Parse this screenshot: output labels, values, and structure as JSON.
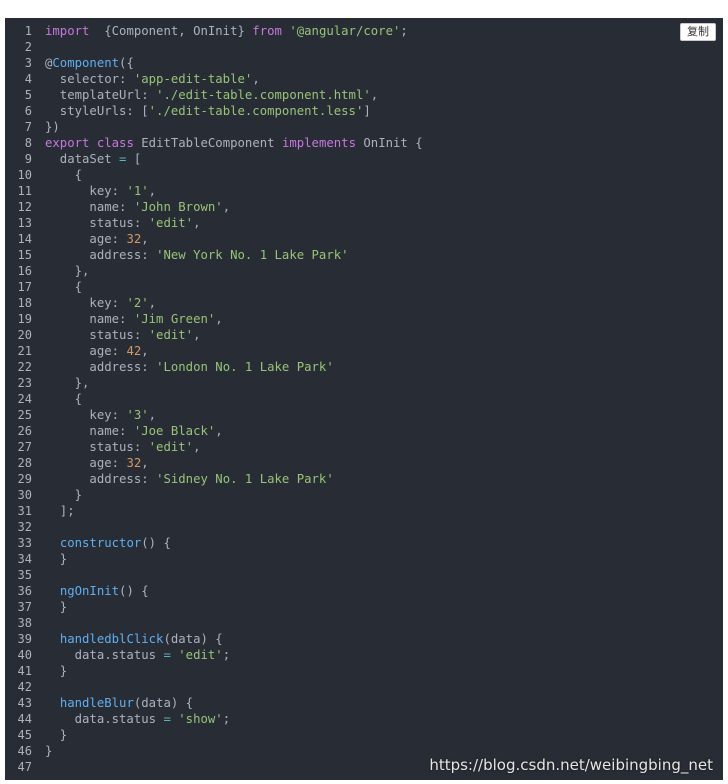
{
  "copy_button": {
    "label": "复制"
  },
  "watermark": "https://blog.csdn.net/weibingbing_net",
  "colors": {
    "background": "#282c34",
    "keyword": "#c678dd",
    "string": "#98c379",
    "function": "#61aeee",
    "number": "#d19a66",
    "text": "#abb2bf"
  },
  "lines": [
    {
      "n": "1",
      "t": [
        [
          "kw",
          "import"
        ],
        [
          "",
          "  {Component, OnInit} "
        ],
        [
          "kw",
          "from"
        ],
        [
          "",
          " "
        ],
        [
          "str",
          "'@angular/core'"
        ],
        [
          "",
          ";"
        ]
      ]
    },
    {
      "n": "2",
      "t": []
    },
    {
      "n": "3",
      "t": [
        [
          "",
          "@"
        ],
        [
          "fn",
          "Component"
        ],
        [
          "",
          "({"
        ]
      ]
    },
    {
      "n": "4",
      "t": [
        [
          "",
          "  selector: "
        ],
        [
          "str",
          "'app-edit-table'"
        ],
        [
          "",
          ","
        ]
      ]
    },
    {
      "n": "5",
      "t": [
        [
          "",
          "  templateUrl: "
        ],
        [
          "str",
          "'./edit-table.component.html'"
        ],
        [
          "",
          ","
        ]
      ]
    },
    {
      "n": "6",
      "t": [
        [
          "",
          "  styleUrls: ["
        ],
        [
          "str",
          "'./edit-table.component.less'"
        ],
        [
          "",
          "]"
        ]
      ]
    },
    {
      "n": "7",
      "t": [
        [
          "",
          "})"
        ]
      ]
    },
    {
      "n": "8",
      "t": [
        [
          "kw",
          "export"
        ],
        [
          "",
          " "
        ],
        [
          "kw",
          "class"
        ],
        [
          "",
          " EditTableComponent "
        ],
        [
          "kw",
          "implements"
        ],
        [
          "",
          " OnInit {"
        ]
      ]
    },
    {
      "n": "9",
      "t": [
        [
          "",
          "  dataSet "
        ],
        [
          "op",
          "="
        ],
        [
          "",
          " ["
        ]
      ]
    },
    {
      "n": "10",
      "t": [
        [
          "",
          "    {"
        ]
      ]
    },
    {
      "n": "11",
      "t": [
        [
          "",
          "      key: "
        ],
        [
          "str",
          "'1'"
        ],
        [
          "",
          ","
        ]
      ]
    },
    {
      "n": "12",
      "t": [
        [
          "",
          "      name: "
        ],
        [
          "str",
          "'John Brown'"
        ],
        [
          "",
          ","
        ]
      ]
    },
    {
      "n": "13",
      "t": [
        [
          "",
          "      status: "
        ],
        [
          "str",
          "'edit'"
        ],
        [
          "",
          ","
        ]
      ]
    },
    {
      "n": "14",
      "t": [
        [
          "",
          "      age: "
        ],
        [
          "num",
          "32"
        ],
        [
          "",
          ","
        ]
      ]
    },
    {
      "n": "15",
      "t": [
        [
          "",
          "      address: "
        ],
        [
          "str",
          "'New York No. 1 Lake Park'"
        ]
      ]
    },
    {
      "n": "16",
      "t": [
        [
          "",
          "    },"
        ]
      ]
    },
    {
      "n": "17",
      "t": [
        [
          "",
          "    {"
        ]
      ]
    },
    {
      "n": "18",
      "t": [
        [
          "",
          "      key: "
        ],
        [
          "str",
          "'2'"
        ],
        [
          "",
          ","
        ]
      ]
    },
    {
      "n": "19",
      "t": [
        [
          "",
          "      name: "
        ],
        [
          "str",
          "'Jim Green'"
        ],
        [
          "",
          ","
        ]
      ]
    },
    {
      "n": "20",
      "t": [
        [
          "",
          "      status: "
        ],
        [
          "str",
          "'edit'"
        ],
        [
          "",
          ","
        ]
      ]
    },
    {
      "n": "21",
      "t": [
        [
          "",
          "      age: "
        ],
        [
          "num",
          "42"
        ],
        [
          "",
          ","
        ]
      ]
    },
    {
      "n": "22",
      "t": [
        [
          "",
          "      address: "
        ],
        [
          "str",
          "'London No. 1 Lake Park'"
        ]
      ]
    },
    {
      "n": "23",
      "t": [
        [
          "",
          "    },"
        ]
      ]
    },
    {
      "n": "24",
      "t": [
        [
          "",
          "    {"
        ]
      ]
    },
    {
      "n": "25",
      "t": [
        [
          "",
          "      key: "
        ],
        [
          "str",
          "'3'"
        ],
        [
          "",
          ","
        ]
      ]
    },
    {
      "n": "26",
      "t": [
        [
          "",
          "      name: "
        ],
        [
          "str",
          "'Joe Black'"
        ],
        [
          "",
          ","
        ]
      ]
    },
    {
      "n": "27",
      "t": [
        [
          "",
          "      status: "
        ],
        [
          "str",
          "'edit'"
        ],
        [
          "",
          ","
        ]
      ]
    },
    {
      "n": "28",
      "t": [
        [
          "",
          "      age: "
        ],
        [
          "num",
          "32"
        ],
        [
          "",
          ","
        ]
      ]
    },
    {
      "n": "29",
      "t": [
        [
          "",
          "      address: "
        ],
        [
          "str",
          "'Sidney No. 1 Lake Park'"
        ]
      ]
    },
    {
      "n": "30",
      "t": [
        [
          "",
          "    }"
        ]
      ]
    },
    {
      "n": "31",
      "t": [
        [
          "",
          "  ];"
        ]
      ]
    },
    {
      "n": "32",
      "t": []
    },
    {
      "n": "33",
      "t": [
        [
          "",
          "  "
        ],
        [
          "fn",
          "constructor"
        ],
        [
          "",
          "() {"
        ]
      ]
    },
    {
      "n": "34",
      "t": [
        [
          "",
          "  }"
        ]
      ]
    },
    {
      "n": "35",
      "t": []
    },
    {
      "n": "36",
      "t": [
        [
          "",
          "  "
        ],
        [
          "fn",
          "ngOnInit"
        ],
        [
          "",
          "() {"
        ]
      ]
    },
    {
      "n": "37",
      "t": [
        [
          "",
          "  }"
        ]
      ]
    },
    {
      "n": "38",
      "t": []
    },
    {
      "n": "39",
      "t": [
        [
          "",
          "  "
        ],
        [
          "fn",
          "handledblClick"
        ],
        [
          "",
          "(data) {"
        ]
      ]
    },
    {
      "n": "40",
      "t": [
        [
          "",
          "    data.status "
        ],
        [
          "op",
          "="
        ],
        [
          "",
          " "
        ],
        [
          "str",
          "'edit'"
        ],
        [
          "",
          ";"
        ]
      ]
    },
    {
      "n": "41",
      "t": [
        [
          "",
          "  }"
        ]
      ]
    },
    {
      "n": "42",
      "t": []
    },
    {
      "n": "43",
      "t": [
        [
          "",
          "  "
        ],
        [
          "fn",
          "handleBlur"
        ],
        [
          "",
          "(data) {"
        ]
      ]
    },
    {
      "n": "44",
      "t": [
        [
          "",
          "    data.status "
        ],
        [
          "op",
          "="
        ],
        [
          "",
          " "
        ],
        [
          "str",
          "'show'"
        ],
        [
          "",
          ";"
        ]
      ]
    },
    {
      "n": "45",
      "t": [
        [
          "",
          "  }"
        ]
      ]
    },
    {
      "n": "46",
      "t": [
        [
          "",
          "}"
        ]
      ]
    },
    {
      "n": "47",
      "t": []
    }
  ]
}
